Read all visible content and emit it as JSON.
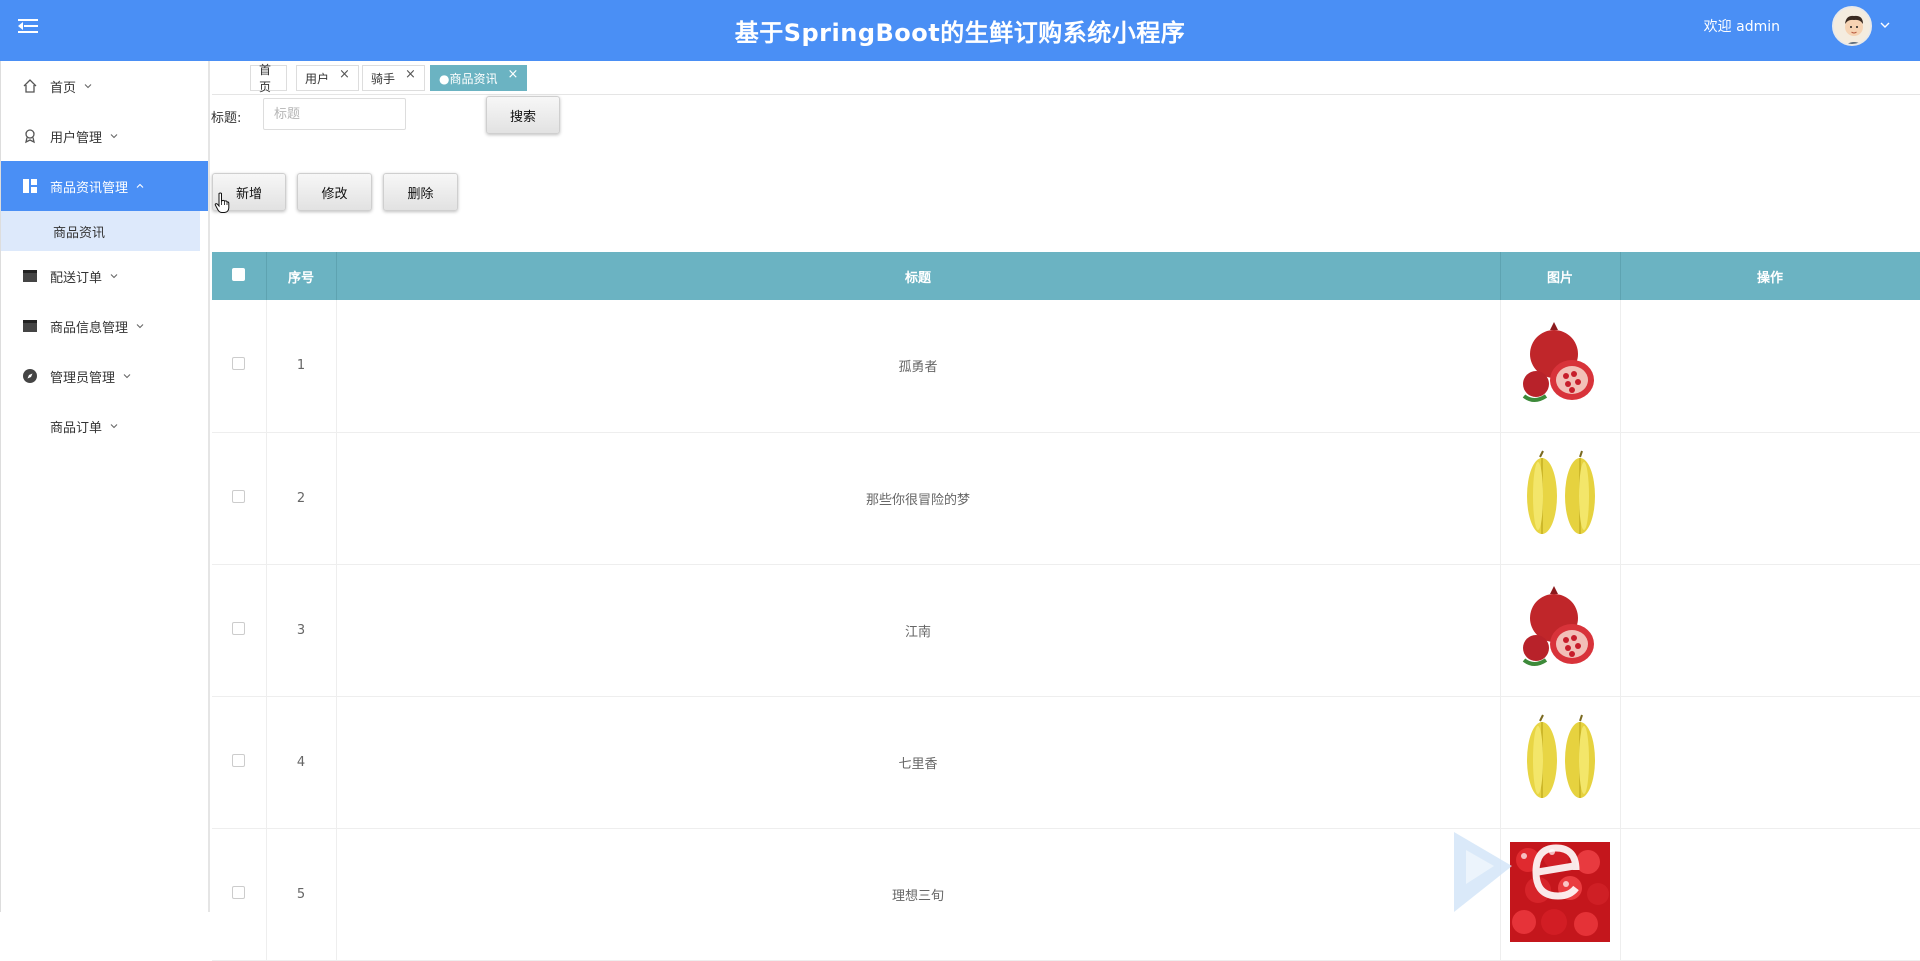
{
  "header": {
    "title": "基于SpringBoot的生鲜订购系统小程序",
    "welcome": "欢迎 admin",
    "color": "#4a8ff5"
  },
  "sidebar": {
    "items": [
      {
        "label": "首页",
        "icon": "home-icon"
      },
      {
        "label": "用户管理",
        "icon": "user-badge-icon"
      },
      {
        "label": "商品资讯管理",
        "icon": "dashboard-icon",
        "active": true
      },
      {
        "label": "配送订单",
        "icon": "box-icon"
      },
      {
        "label": "商品信息管理",
        "icon": "box-icon"
      },
      {
        "label": "管理员管理",
        "icon": "compass-icon"
      },
      {
        "label": "商品订单",
        "icon": ""
      }
    ],
    "sub_items": [
      {
        "label": "商品资讯"
      }
    ]
  },
  "tabs": [
    {
      "label": "首页",
      "closable": false
    },
    {
      "label": "用户",
      "closable": true
    },
    {
      "label": "骑手",
      "closable": true
    },
    {
      "label": "●商品资讯",
      "closable": true,
      "active": true
    }
  ],
  "search": {
    "label": "标题:",
    "placeholder": "标题",
    "button": "搜索"
  },
  "actions": {
    "add": "新增",
    "edit": "修改",
    "delete": "删除"
  },
  "table": {
    "header_color": "#6bb3c2",
    "columns": [
      "序号",
      "标题",
      "图片",
      "操作"
    ],
    "rows": [
      {
        "index": "1",
        "title": "孤勇者",
        "image": "pomegranate"
      },
      {
        "index": "2",
        "title": "那些你很冒险的梦",
        "image": "starfruit"
      },
      {
        "index": "3",
        "title": "江南",
        "image": "pomegranate"
      },
      {
        "index": "4",
        "title": "七里香",
        "image": "starfruit"
      },
      {
        "index": "5",
        "title": "理想三旬",
        "image": "cherries"
      }
    ]
  }
}
